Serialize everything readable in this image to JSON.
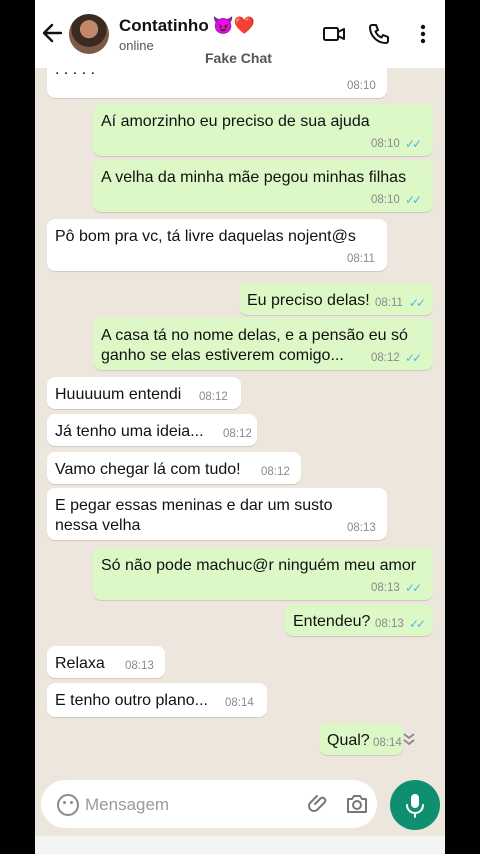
{
  "header": {
    "contact_name": "Contatinho",
    "contact_emojis": "😈❤️",
    "status": "online",
    "watermark": "Fake Chat",
    "icons": [
      "back-arrow-icon",
      "video-call-icon",
      "voice-call-icon",
      "more-options-icon"
    ]
  },
  "messages": [
    {
      "dir": "in",
      "text": ". . . . .",
      "time": "08:10"
    },
    {
      "dir": "out",
      "text": "Aí amorzinho eu preciso de sua ajuda",
      "time": "08:10",
      "ticks": "✓✓"
    },
    {
      "dir": "out",
      "text": "A velha da minha mãe pegou minhas filhas",
      "time": "08:10",
      "ticks": "✓✓"
    },
    {
      "dir": "in",
      "text": "Pô bom pra vc, tá livre daquelas nojent@s",
      "time": "08:11"
    },
    {
      "dir": "out",
      "text": "Eu preciso delas!",
      "time": "08:11",
      "ticks": "✓✓"
    },
    {
      "dir": "out",
      "text": "A casa tá no nome delas, e a pensão eu só\nganho se elas estiverem comigo...",
      "time": "08:12",
      "ticks": "✓✓"
    },
    {
      "dir": "in",
      "text": "Huuuuum entendi",
      "time": "08:12"
    },
    {
      "dir": "in",
      "text": "Já tenho uma ideia...",
      "time": "08:12"
    },
    {
      "dir": "in",
      "text": "Vamo chegar lá com tudo!",
      "time": "08:12"
    },
    {
      "dir": "in",
      "text": "E pegar essas meninas e dar um susto\nnessa velha",
      "time": "08:13"
    },
    {
      "dir": "out",
      "text": "Só não pode machuc@r ninguém meu amor",
      "time": "08:13",
      "ticks": "✓✓"
    },
    {
      "dir": "out",
      "text": "Entendeu?",
      "time": "08:13",
      "ticks": "✓✓"
    },
    {
      "dir": "in",
      "text": "Relaxa",
      "time": "08:13"
    },
    {
      "dir": "in",
      "text": "E tenho outro plano...",
      "time": "08:14"
    },
    {
      "dir": "out",
      "text": "Qual?",
      "time": "08:14",
      "ticks": ""
    }
  ],
  "composer": {
    "placeholder": "Mensagem",
    "icons": [
      "emoji-icon",
      "attach-icon",
      "camera-icon",
      "mic-icon"
    ]
  },
  "colors": {
    "chat_background": "#ede6dd",
    "outgoing_bubble": "#dcf8c6",
    "incoming_bubble": "#ffffff",
    "read_ticks": "#4fb6ec",
    "mic_button": "#0f8f6f"
  }
}
